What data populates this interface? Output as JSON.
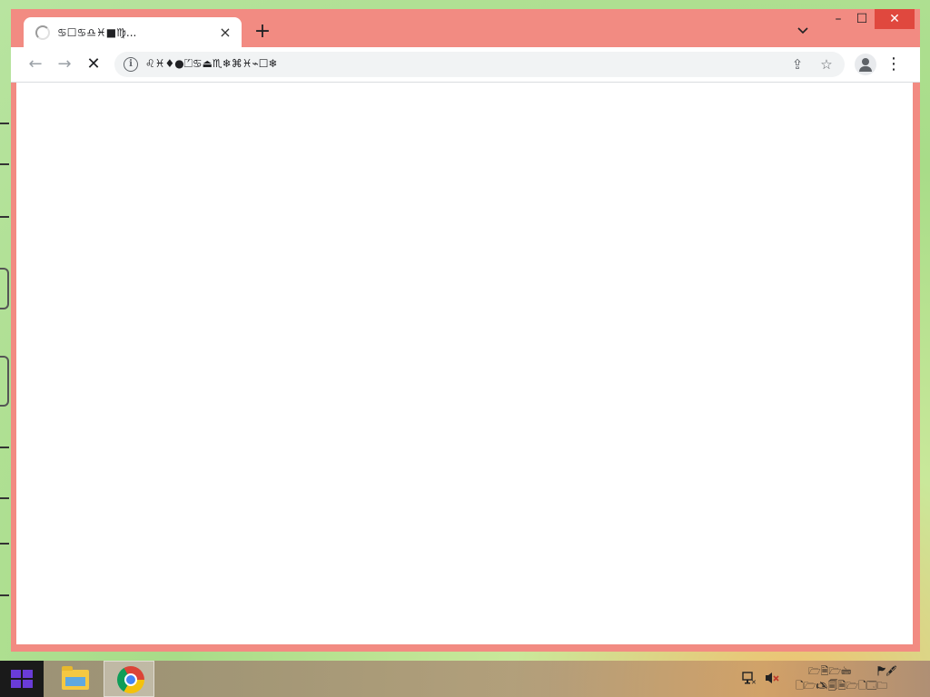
{
  "browser": {
    "tab": {
      "title": "♋☐♋♎♓■♍...",
      "close_icon": "×"
    },
    "new_tab_icon": "+",
    "tab_search_icon": "chevron-down",
    "window_controls": {
      "minimize": "–",
      "maximize": "☐",
      "close": "✕"
    },
    "toolbar": {
      "back_icon": "←",
      "forward_icon": "→",
      "stop_icon": "✕",
      "url": "♌♓♦●⏍♋⏏♏❄⌘♓⌁☐❄",
      "share_icon": "⇪",
      "bookmark_icon": "☆",
      "menu_icon": "⋮"
    },
    "colors": {
      "frame": "#f28b82",
      "close_button": "#e0483e"
    }
  },
  "taskbar": {
    "apps": [
      {
        "name": "File Explorer",
        "active": false
      },
      {
        "name": "Google Chrome",
        "active": true
      }
    ],
    "tray": {
      "network_icon": "network-icon",
      "volume_icon": "volume-muted-icon"
    },
    "clock": {
      "time": "🗁🗎🗁🖮",
      "time_suffix": "🏲🖋",
      "date": "🗋🗁🖎🗐🗎🗁🗋🗔🗀"
    }
  }
}
